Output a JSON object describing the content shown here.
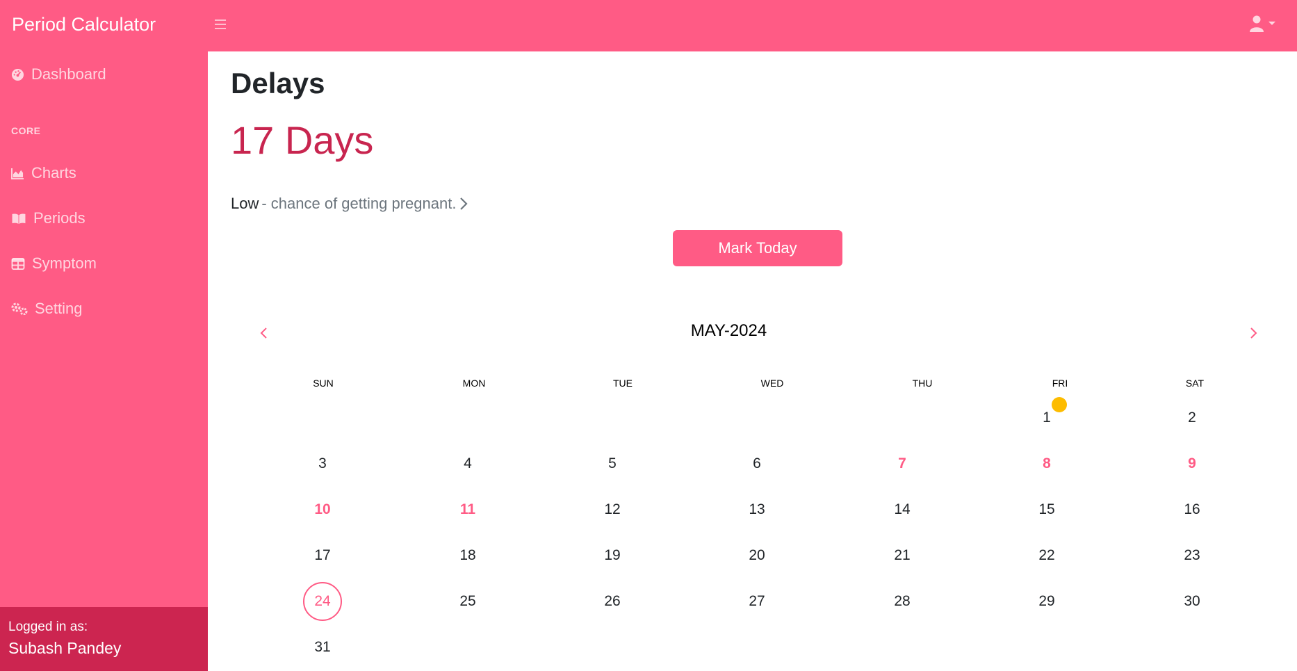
{
  "app": {
    "title": "Period Calculator"
  },
  "sidebar": {
    "items": [
      {
        "label": "Dashboard",
        "icon": "dashboard-icon"
      },
      {
        "label": "Charts",
        "icon": "chart-area-icon"
      },
      {
        "label": "Periods",
        "icon": "book-open-icon"
      },
      {
        "label": "Symptom",
        "icon": "table-icon"
      },
      {
        "label": "Setting",
        "icon": "gears-icon"
      }
    ],
    "section_label": "CORE",
    "footer": {
      "logged_in_label": "Logged in as:",
      "user_name": "Subash Pandey"
    }
  },
  "main": {
    "title": "Delays",
    "delay_value": "17 Days",
    "chance": {
      "level": "Low",
      "text": " - chance of getting pregnant."
    },
    "mark_button": "Mark Today"
  },
  "calendar": {
    "month_label": "MAY-2024",
    "weekdays": [
      "SUN",
      "MON",
      "TUE",
      "WED",
      "THU",
      "FRI",
      "SAT"
    ],
    "days": [
      "1",
      "2",
      "3",
      "4",
      "5",
      "6",
      "7",
      "8",
      "9",
      "10",
      "11",
      "12",
      "13",
      "14",
      "15",
      "16",
      "17",
      "18",
      "19",
      "20",
      "21",
      "22",
      "23",
      "24",
      "25",
      "26",
      "27",
      "28",
      "29",
      "30",
      "31"
    ],
    "first_weekday_index": 5,
    "highlighted_days": [
      7,
      8,
      9,
      10,
      11
    ],
    "today": 24,
    "event_day": 1
  },
  "colors": {
    "primary": "#ff5b85",
    "footer": "#cc2550",
    "delay_text": "#c8254f",
    "event_dot": "#fdbc00"
  }
}
